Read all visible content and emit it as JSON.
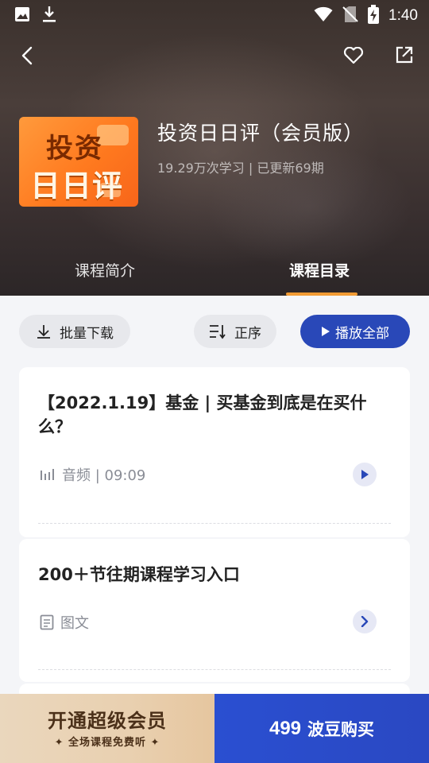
{
  "status_bar": {
    "time": "1:40"
  },
  "course": {
    "cover_line1": "投资",
    "cover_line2": "日日评",
    "title": "投资日日评（会员版）",
    "meta": "19.29万次学习 | 已更新69期"
  },
  "tabs": [
    {
      "label": "课程简介",
      "active": false
    },
    {
      "label": "课程目录",
      "active": true
    }
  ],
  "toolbar": {
    "batch_download": "批量下载",
    "order": "正序",
    "play_all": "播放全部"
  },
  "items": [
    {
      "title": "【2022.1.19】基金 | 买基金到底是在买什么？",
      "type_label": "音频 | 09:09",
      "type_icon": "audio-bars-icon",
      "action_icon": "play-icon"
    },
    {
      "title": "200＋节往期课程学习入口",
      "type_label": "图文",
      "type_icon": "document-icon",
      "action_icon": "chevron-right-icon"
    }
  ],
  "bottom": {
    "vip_title": "开通超级会员",
    "vip_sub": "✦ 全场课程免费听 ✦",
    "price": "499",
    "buy_label": "波豆购买"
  },
  "colors": {
    "accent_blue": "#2948b8",
    "tab_underline": "#f19a33",
    "cover_orange": "#ff7a1f",
    "vip_gold": "#e9d0b0"
  }
}
